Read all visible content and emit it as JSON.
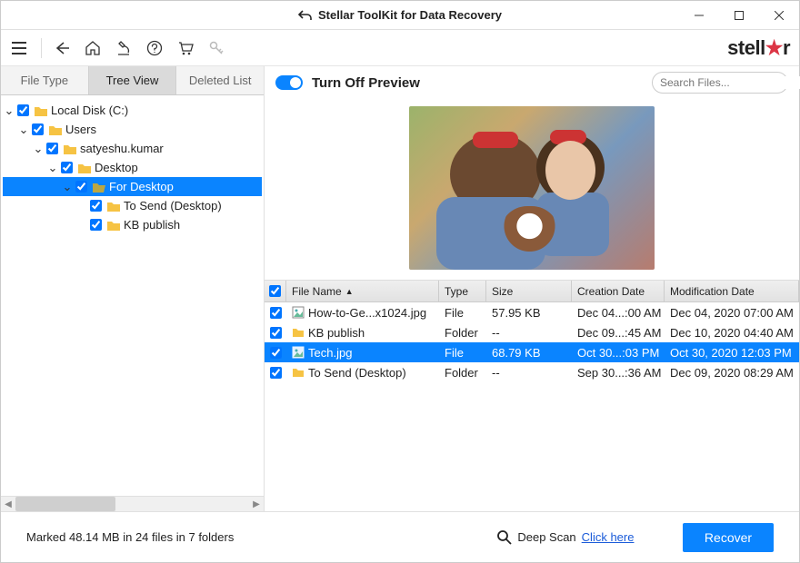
{
  "title": "Stellar ToolKit for Data Recovery",
  "brand": {
    "prefix": "stell",
    "star": "★",
    "suffix": "r"
  },
  "leftTabs": {
    "fileType": "File Type",
    "treeView": "Tree View",
    "deletedList": "Deleted List"
  },
  "tree": {
    "0": {
      "label": "Local Disk (C:)"
    },
    "1": {
      "label": "Users"
    },
    "2": {
      "label": "satyeshu.kumar"
    },
    "3": {
      "label": "Desktop"
    },
    "4": {
      "label": "For Desktop"
    },
    "5": {
      "label": "To Send (Desktop)"
    },
    "6": {
      "label": "KB publish"
    }
  },
  "previewToggle": "Turn Off Preview",
  "search": {
    "placeholder": "Search Files..."
  },
  "columns": {
    "name": "File Name",
    "type": "Type",
    "size": "Size",
    "created": "Creation Date",
    "modified": "Modification Date"
  },
  "rows": {
    "0": {
      "name": "How-to-Ge...x1024.jpg",
      "type": "File",
      "size": "57.95 KB",
      "created": "Dec 04...:00 AM",
      "modified": "Dec 04, 2020 07:00 AM"
    },
    "1": {
      "name": "KB publish",
      "type": "Folder",
      "size": "--",
      "created": "Dec 09...:45 AM",
      "modified": "Dec 10, 2020 04:40 AM"
    },
    "2": {
      "name": "Tech.jpg",
      "type": "File",
      "size": "68.79 KB",
      "created": "Oct 30...:03 PM",
      "modified": "Oct 30, 2020 12:03 PM"
    },
    "3": {
      "name": "To Send (Desktop)",
      "type": "Folder",
      "size": "--",
      "created": "Sep 30...:36 AM",
      "modified": "Dec 09, 2020 08:29 AM"
    }
  },
  "status": "Marked 48.14 MB in 24 files in 7 folders",
  "deepScan": {
    "label": "Deep Scan",
    "link": "Click here"
  },
  "recover": "Recover"
}
